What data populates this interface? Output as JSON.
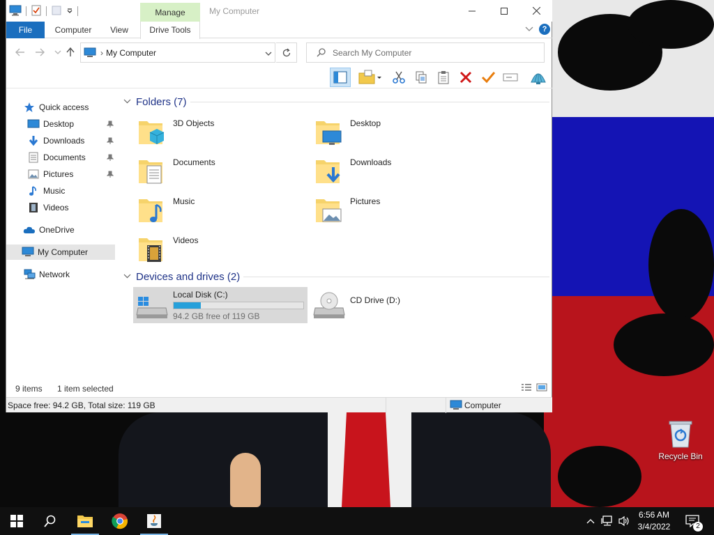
{
  "window": {
    "title": "My Computer",
    "context_tab": "Manage",
    "tabs": {
      "file": "File",
      "computer": "Computer",
      "view": "View",
      "drive_tools": "Drive Tools"
    }
  },
  "address": {
    "path": "My Computer",
    "search_placeholder": "Search My Computer"
  },
  "sidebar": {
    "items": [
      {
        "label": "Quick access",
        "icon": "star-icon",
        "pinned": false
      },
      {
        "label": "Desktop",
        "icon": "desktop-icon",
        "pinned": true
      },
      {
        "label": "Downloads",
        "icon": "download-icon",
        "pinned": true
      },
      {
        "label": "Documents",
        "icon": "document-icon",
        "pinned": true
      },
      {
        "label": "Pictures",
        "icon": "picture-icon",
        "pinned": true
      },
      {
        "label": "Music",
        "icon": "music-icon",
        "pinned": false
      },
      {
        "label": "Videos",
        "icon": "video-icon",
        "pinned": false
      },
      {
        "label": "OneDrive",
        "icon": "cloud-icon",
        "pinned": false
      },
      {
        "label": "My Computer",
        "icon": "computer-icon",
        "pinned": false
      },
      {
        "label": "Network",
        "icon": "network-icon",
        "pinned": false
      }
    ]
  },
  "content": {
    "folders_header": "Folders (7)",
    "folders": [
      "3D Objects",
      "Desktop",
      "Documents",
      "Downloads",
      "Music",
      "Pictures",
      "Videos"
    ],
    "drives_header": "Devices and drives (2)",
    "drives": [
      {
        "name": "Local Disk (C:)",
        "free_text": "94.2 GB free of 119 GB",
        "used_fraction": 0.21
      },
      {
        "name": "CD Drive (D:)"
      }
    ]
  },
  "status": {
    "items": "9 items",
    "selected": "1 item selected"
  },
  "bottom": {
    "space": "Space free: 94.2 GB, Total size: 119 GB",
    "location": "Computer"
  },
  "desktop": {
    "recycle_bin": "Recycle Bin"
  },
  "taskbar": {
    "time": "6:56 AM",
    "date": "3/4/2022",
    "notifications": "2"
  },
  "colors": {
    "accent": "#1a6ebe",
    "selection": "#e5e5e5",
    "manage_tab": "#d7f0c6",
    "progress": "#26a0da"
  }
}
